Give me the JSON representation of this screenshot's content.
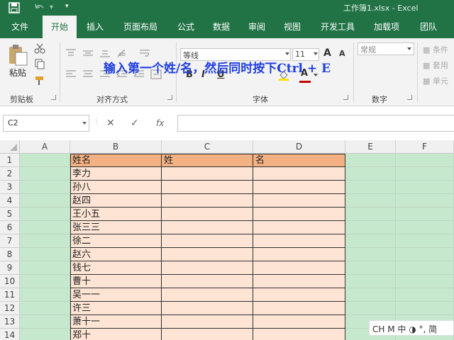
{
  "titlebar": {
    "title": "工作簿1.xlsx  -  Excel"
  },
  "tabs": [
    {
      "label": "文件"
    },
    {
      "label": "开始"
    },
    {
      "label": "插入"
    },
    {
      "label": "页面布局"
    },
    {
      "label": "公式"
    },
    {
      "label": "数据"
    },
    {
      "label": "审阅"
    },
    {
      "label": "视图"
    },
    {
      "label": "开发工具"
    },
    {
      "label": "加载项"
    },
    {
      "label": "团队"
    }
  ],
  "ribbon": {
    "paste_label": "粘贴",
    "groups": {
      "clipboard": "剪贴板",
      "alignment": "对齐方式",
      "font": "字体",
      "number": "数字"
    },
    "font_name": "等线",
    "font_size": "11",
    "number_format": "常规",
    "bold": "B",
    "italic": "I",
    "underline": "U",
    "increase_font": "A",
    "decrease_font": "A",
    "font_color": "A",
    "right_items": [
      "条件",
      "套用",
      "单元"
    ],
    "overlay_text": "输入第一个姓/名，然后同时按下Ctrl + E"
  },
  "formula_bar": {
    "name_box": "C2",
    "cancel": "✕",
    "enter": "✓",
    "fx": "fx",
    "value": ""
  },
  "grid": {
    "columns": [
      "A",
      "B",
      "C",
      "D",
      "E",
      "F"
    ],
    "rows": [
      "1",
      "2",
      "3",
      "4",
      "5",
      "6",
      "7",
      "8",
      "9",
      "10",
      "11",
      "12",
      "13",
      "14"
    ],
    "headers": [
      "姓名",
      "姓",
      "名"
    ],
    "names": [
      "李力",
      "孙八",
      "赵四",
      "王小五",
      "张三三",
      "徐二",
      "赵六",
      "钱七",
      "曹十",
      "吴一一",
      "许三",
      "萧十一",
      "郑十"
    ]
  },
  "ime": {
    "text": "CH  M  中  ◑  °,  简"
  }
}
